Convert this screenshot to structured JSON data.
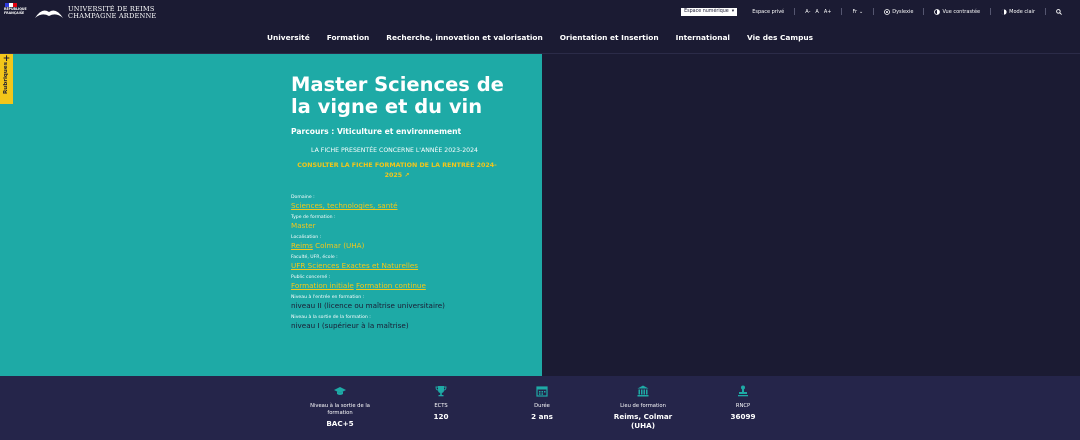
{
  "header": {
    "rf_logo_text": [
      "RÉPUBLIQUE",
      "FRANÇAISE"
    ],
    "urca_lines": [
      "UNIVERSITÉ DE REIMS",
      "CHAMPAGNE ARDENNE"
    ],
    "espace_numerique": "Espace numérique",
    "espace_prive": "Espace privé",
    "font_sizes": [
      "A-",
      "A",
      "A+"
    ],
    "language": "Fr",
    "dyslexie": "Dyslexie",
    "contraste": "Vue contrastée",
    "mode_clair": "Mode clair"
  },
  "nav": {
    "items": [
      "Université",
      "Formation",
      "Recherche, innovation et valorisation",
      "Orientation et Insertion",
      "International",
      "Vie des Campus"
    ]
  },
  "sidebar": {
    "rubriques": "Rubriques"
  },
  "hero": {
    "title": "Master Sciences de la vigne et du vin",
    "parcours": "Parcours : Viticulture et environnement",
    "annee_notice": "LA FICHE PRESENTÉE CONCERNE L'ANNÉE 2023-2024",
    "consulter_link": "CONSULTER LA FICHE FORMATION DE LA RENTRÉE 2024-2025"
  },
  "facts": {
    "domaine": {
      "label": "Domaine :",
      "values": [
        "Sciences, technologies, santé"
      ]
    },
    "type": {
      "label": "Type de formation :",
      "values": [
        "Master"
      ]
    },
    "localisation": {
      "label": "Localisation :",
      "values": [
        "Reims",
        "Colmar (UHA)"
      ]
    },
    "faculte": {
      "label": "Faculté, UFR, école :",
      "values": [
        "UFR Sciences Exactes et Naturelles"
      ]
    },
    "public": {
      "label": "Public concerné :",
      "values": [
        "Formation initiale",
        "Formation continue"
      ]
    },
    "niveau_entree": {
      "label": "Niveau à l'entrée en formation :",
      "value": "niveau II (licence ou maîtrise universitaire)"
    },
    "niveau_sortie": {
      "label": "Niveau à la sortie de la formation :",
      "value": "niveau I (supérieur à la maîtrise)"
    }
  },
  "stats": [
    {
      "icon": "graduation-cap-icon",
      "label": "Niveau à la sortie de la formation",
      "value": "BAC+5"
    },
    {
      "icon": "trophy-icon",
      "label": "ECTS",
      "value": "120"
    },
    {
      "icon": "calendar-icon",
      "label": "Durée",
      "value": "2 ans"
    },
    {
      "icon": "building-icon",
      "label": "Lieu de formation",
      "value": "Reims, Colmar (UHA)"
    },
    {
      "icon": "stamp-icon",
      "label": "RNCP",
      "value": "36099"
    }
  ],
  "colors": {
    "background": "#1b1b33",
    "hero": "#1eaaa6",
    "accent": "#f3c61a",
    "stats_bar": "#25254a"
  }
}
